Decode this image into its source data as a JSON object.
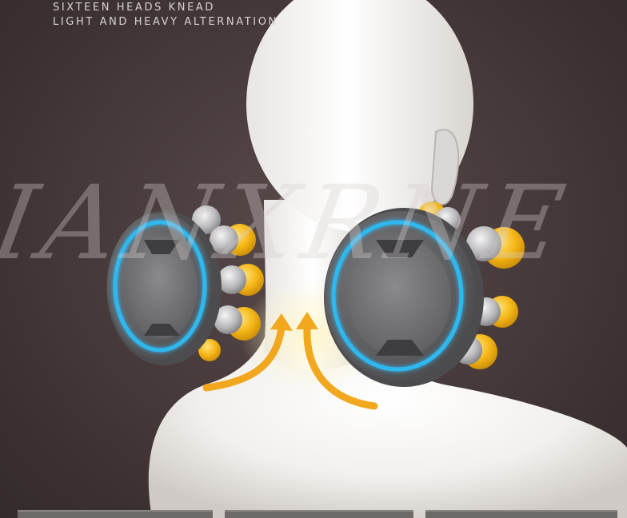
{
  "caption": {
    "line1": "SIXTEEN HEADS KNEAD",
    "line2": "LIGHT AND HEAVY ALTERNATION"
  },
  "watermark": {
    "text": "IANXRNE"
  },
  "colors": {
    "background": "#463a3a",
    "figure": "#f4f2ef",
    "ring_glow": "#2fb8f0",
    "roller_gold": "#f4b51a",
    "arrow_orange": "#f2a81e",
    "disc_gray": "#6a6a6c"
  },
  "icons": {
    "left_massage_head": "massage-roller-disc",
    "right_massage_head": "massage-roller-disc",
    "arrows": "upward-curved-arrow"
  }
}
